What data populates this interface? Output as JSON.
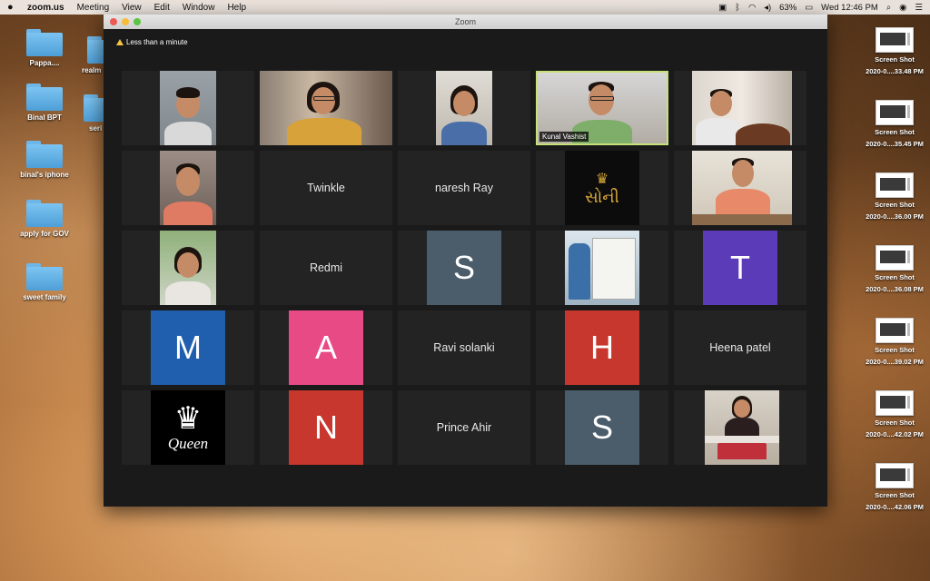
{
  "menubar": {
    "app": "zoom.us",
    "items": [
      "Meeting",
      "View",
      "Edit",
      "Window",
      "Help"
    ],
    "battery": "63%",
    "datetime": "Wed 12:46 PM"
  },
  "desktop": {
    "folders": [
      "Pappa....",
      "Binal BPT",
      "binal's iphone",
      "apply for GOV",
      "sweet family"
    ],
    "folders_partial": [
      "realm",
      "seri"
    ],
    "screenshots": [
      {
        "line1": "Screen Shot",
        "line2": "2020-0....33.48 PM"
      },
      {
        "line1": "Screen Shot",
        "line2": "2020-0....35.45 PM"
      },
      {
        "line1": "Screen Shot",
        "line2": "2020-0....36.00 PM"
      },
      {
        "line1": "Screen Shot",
        "line2": "2020-0....36.08 PM"
      },
      {
        "line1": "Screen Shot",
        "line2": "2020-0....39.02 PM"
      },
      {
        "line1": "Screen Shot",
        "line2": "2020-0....42.02 PM"
      },
      {
        "line1": "Screen Shot",
        "line2": "2020-0....42.06 PM"
      }
    ]
  },
  "window": {
    "title": "Zoom",
    "notice": "Less than a minute"
  },
  "tiles": {
    "r0c3_name": "Kunal Vashist",
    "r1c1": "Twinkle",
    "r1c2": "naresh Ray",
    "r1c3_logo_text": "સોની",
    "r2c1": "Redmi",
    "r2c2": "S",
    "r2c4": "T",
    "r3c0": "M",
    "r3c1": "A",
    "r3c2": "Ravi solanki",
    "r3c3": "H",
    "r3c4": "Heena patel",
    "r4c0_logo_text": "Queen",
    "r4c1": "N",
    "r4c2": "Prince Ahir",
    "r4c3": "S"
  },
  "colors": {
    "slate": "#4b5d6a",
    "purple": "#5c3bb8",
    "blue": "#1f5fae",
    "pink": "#e84a86",
    "red": "#c7372e",
    "active_border": "#c6e07a"
  }
}
